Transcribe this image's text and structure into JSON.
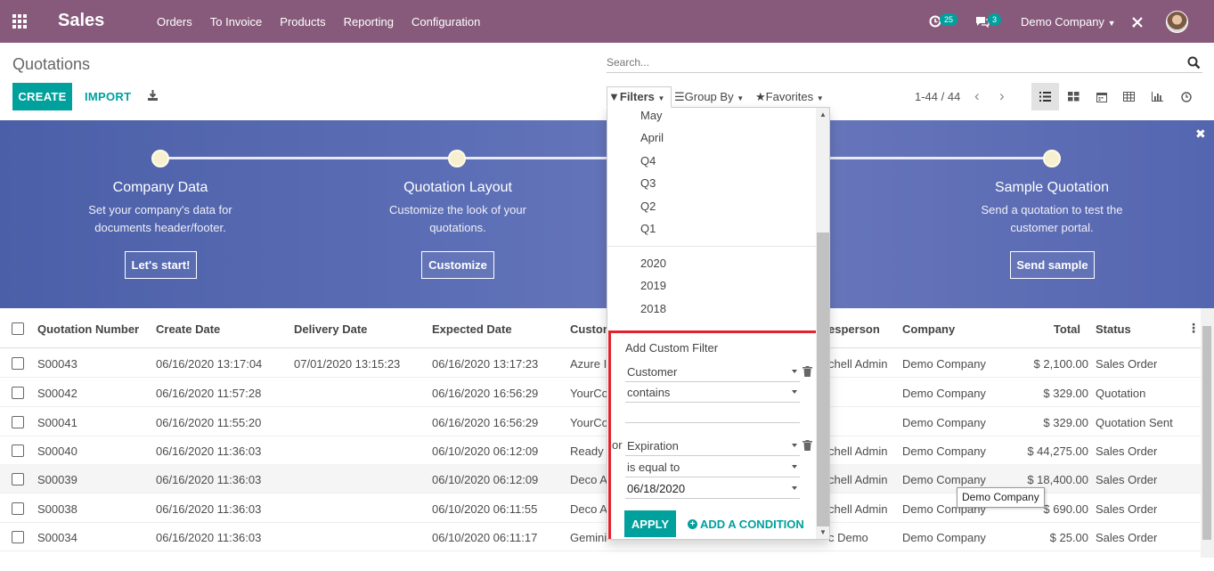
{
  "navbar": {
    "app_name": "Sales",
    "menu": [
      "Orders",
      "To Invoice",
      "Products",
      "Reporting",
      "Configuration"
    ],
    "activity_count": "25",
    "message_count": "3",
    "company": "Demo Company"
  },
  "control_panel": {
    "title": "Quotations",
    "search_placeholder": "Search...",
    "create_label": "CREATE",
    "import_label": "IMPORT",
    "filters_label": "Filters",
    "groupby_label": "Group By",
    "favorites_label": "Favorites",
    "pager": "1-44 / 44"
  },
  "banner": {
    "steps": [
      {
        "title": "Company Data",
        "desc1": "Set your company's data for",
        "desc2": "documents header/footer.",
        "button": "Let's start!"
      },
      {
        "title": "Quotation Layout",
        "desc1": "Customize the look of your",
        "desc2": "quotations.",
        "button": "Customize"
      },
      {
        "title": "Sample Quotation",
        "desc1": "Send a quotation to test the",
        "desc2": "customer portal.",
        "button": "Send sample"
      }
    ]
  },
  "table": {
    "headers": {
      "number": "Quotation Number",
      "create_date": "Create Date",
      "delivery_date": "Delivery Date",
      "expected_date": "Expected Date",
      "customer": "Custom",
      "salesperson": "esperson",
      "company": "Company",
      "total": "Total",
      "status": "Status"
    },
    "rows": [
      {
        "number": "S00043",
        "create_date": "06/16/2020 13:17:04",
        "delivery_date": "07/01/2020 13:15:23",
        "expected_date": "06/16/2020 13:17:23",
        "customer": "Azure I",
        "salesperson": "chell Admin",
        "company": "Demo Company",
        "total": "$ 2,100.00",
        "status": "Sales Order"
      },
      {
        "number": "S00042",
        "create_date": "06/16/2020 11:57:28",
        "delivery_date": "",
        "expected_date": "06/16/2020 16:56:29",
        "customer": "YourCo",
        "salesperson": "",
        "company": "Demo Company",
        "total": "$ 329.00",
        "status": "Quotation"
      },
      {
        "number": "S00041",
        "create_date": "06/16/2020 11:55:20",
        "delivery_date": "",
        "expected_date": "06/16/2020 16:56:29",
        "customer": "YourCo",
        "salesperson": "",
        "company": "Demo Company",
        "total": "$ 329.00",
        "status": "Quotation Sent"
      },
      {
        "number": "S00040",
        "create_date": "06/16/2020 11:36:03",
        "delivery_date": "",
        "expected_date": "06/10/2020 06:12:09",
        "customer": "Ready I",
        "salesperson": "chell Admin",
        "company": "Demo Company",
        "total": "$ 44,275.00",
        "status": "Sales Order"
      },
      {
        "number": "S00039",
        "create_date": "06/16/2020 11:36:03",
        "delivery_date": "",
        "expected_date": "06/10/2020 06:12:09",
        "customer": "Deco A",
        "salesperson": "chell Admin",
        "company": "Demo Company",
        "total": "$ 18,400.00",
        "status": "Sales Order"
      },
      {
        "number": "S00038",
        "create_date": "06/16/2020 11:36:03",
        "delivery_date": "",
        "expected_date": "06/10/2020 06:11:55",
        "customer": "Deco A",
        "salesperson": "chell Admin",
        "company": "Demo Company",
        "total": "$ 690.00",
        "status": "Sales Order"
      },
      {
        "number": "S00034",
        "create_date": "06/16/2020 11:36:03",
        "delivery_date": "",
        "expected_date": "06/10/2020 06:11:17",
        "customer": "Gemini",
        "salesperson": "c Demo",
        "company": "Demo Company",
        "total": "$ 25.00",
        "status": "Sales Order"
      }
    ]
  },
  "filters_dropdown": {
    "periods": [
      "May",
      "April",
      "Q4",
      "Q3",
      "Q2",
      "Q1"
    ],
    "years": [
      "2020",
      "2019",
      "2018"
    ],
    "custom_title": "Add Custom Filter",
    "cond1_field": "Customer",
    "cond1_op": "contains",
    "cond1_value": "",
    "or_label": "or",
    "cond2_field": "Expiration",
    "cond2_op": "is equal to",
    "cond2_value": "06/18/2020",
    "apply_label": "APPLY",
    "add_condition_label": "ADD A CONDITION"
  },
  "tooltip": "Demo Company",
  "colors": {
    "navbar": "#875a7b",
    "primary": "#00a09d",
    "highlight_box": "#e3222b"
  }
}
